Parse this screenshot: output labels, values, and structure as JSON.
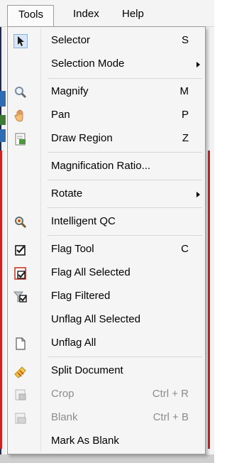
{
  "menubar": {
    "tools": "Tools",
    "index": "Index",
    "help": "Help"
  },
  "menu": {
    "items": [
      {
        "label": "Selector",
        "shortcut": "S",
        "icon": "cursor-arrow-icon"
      },
      {
        "label": "Selection Mode",
        "submenu": true
      },
      {
        "label": "Magnify",
        "shortcut": "M",
        "icon": "magnifier-icon"
      },
      {
        "label": "Pan",
        "shortcut": "P",
        "icon": "hand-icon"
      },
      {
        "label": "Draw Region",
        "shortcut": "Z",
        "icon": "draw-region-icon"
      },
      {
        "label": "Magnification Ratio..."
      },
      {
        "label": "Rotate",
        "submenu": true
      },
      {
        "label": "Intelligent QC",
        "icon": "intelligent-qc-icon"
      },
      {
        "label": "Flag Tool",
        "shortcut": "C",
        "icon": "checkbox-icon"
      },
      {
        "label": "Flag All Selected",
        "icon": "flag-all-selected-icon"
      },
      {
        "label": "Flag Filtered",
        "icon": "flag-filtered-icon"
      },
      {
        "label": "Unflag All Selected"
      },
      {
        "label": "Unflag All",
        "icon": "blank-page-icon"
      },
      {
        "label": "Split Document",
        "icon": "split-document-icon"
      },
      {
        "label": "Crop",
        "shortcut": "Ctrl + R",
        "icon": "crop-icon",
        "disabled": true
      },
      {
        "label": "Blank",
        "shortcut": "Ctrl + B",
        "icon": "blank-icon",
        "disabled": true
      },
      {
        "label": "Mark As Blank"
      }
    ]
  }
}
